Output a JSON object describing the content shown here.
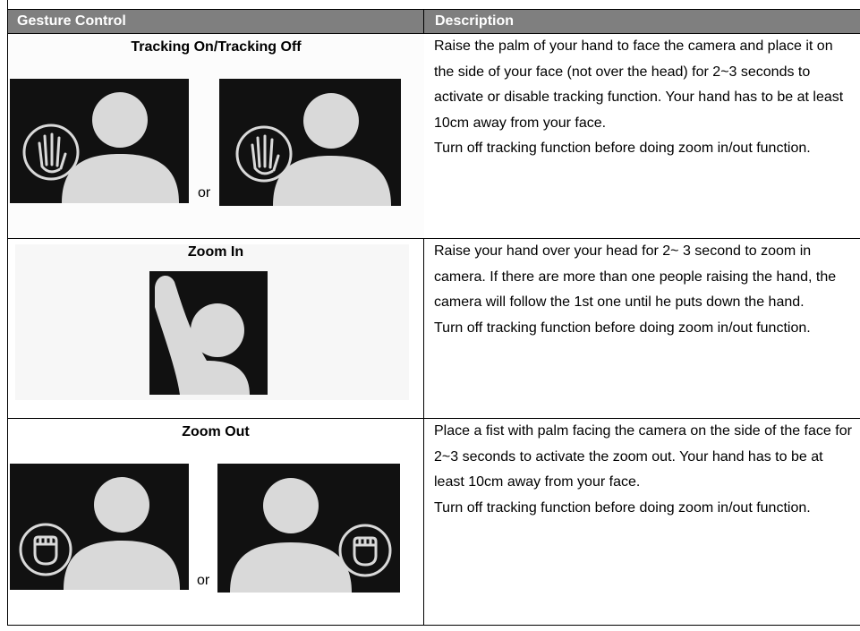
{
  "table": {
    "headers": [
      "Gesture Control",
      "Description"
    ],
    "rows": [
      {
        "title": "Tracking On/Tracking Off",
        "separator": "or",
        "icons": [
          "raised-palm-icon",
          "raised-palm-icon"
        ],
        "description": [
          "Raise the palm of your hand to face the camera and place it on the side of your face (not over the head) for 2~3 seconds to activate or disable tracking function. Your hand has to be at least 10cm away from your face.",
          "Turn off tracking function before doing zoom in/out function."
        ]
      },
      {
        "title": "Zoom In",
        "icons": [
          "hand-over-head-icon"
        ],
        "description": [
          "Raise your hand over your head for 2~ 3 second to zoom in camera. If there are more than one people raising the hand, the camera will follow the 1st one until he puts down the hand.",
          "Turn off tracking function before doing zoom in/out function."
        ]
      },
      {
        "title": "Zoom Out",
        "separator": "or",
        "icons": [
          "fist-icon",
          "fist-icon"
        ],
        "description": [
          "Place a fist with palm facing the camera on the side of the face for 2~3 seconds to activate the zoom out. Your hand has to be at least 10cm away from your face.",
          "Turn off tracking function before doing zoom in/out function."
        ]
      }
    ]
  },
  "colors": {
    "header_bg": "#7f7f7f",
    "image_bg": "#111111",
    "figure": "#d9d9d9"
  }
}
